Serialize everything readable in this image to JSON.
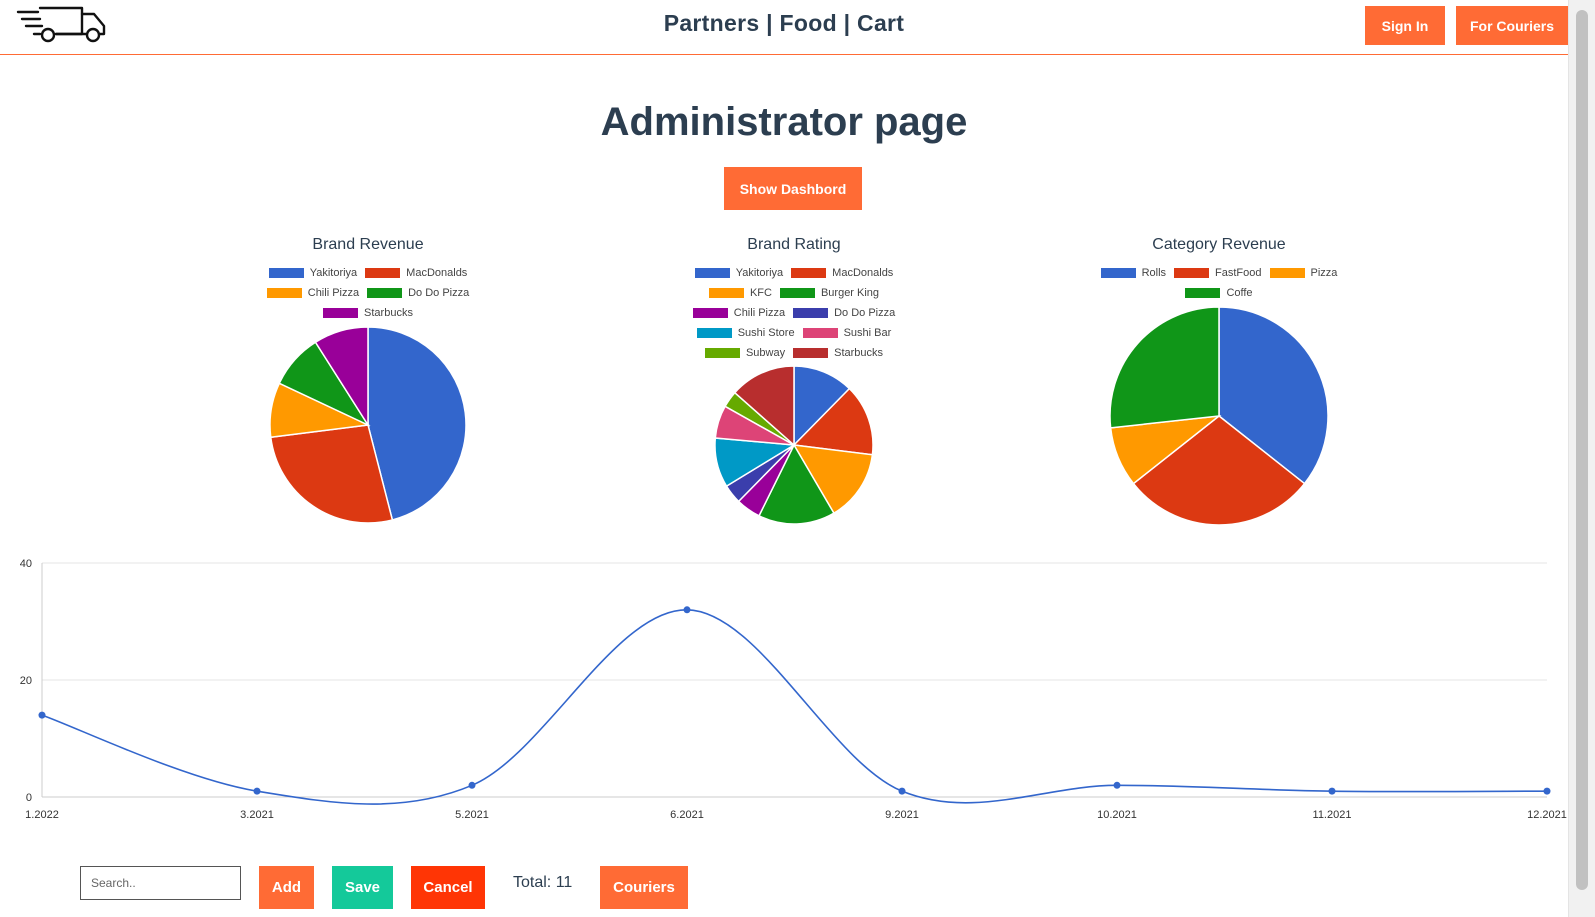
{
  "header": {
    "title": "Partners | Food | Cart",
    "sign_in_label": "Sign In",
    "for_couriers_label": "For Couriers",
    "logo_icon": "delivery-truck-icon"
  },
  "page_title": "Administrator page",
  "show_dashboard_label": "Show Dashbord",
  "chart_data": [
    {
      "type": "pie",
      "title": "Brand Revenue",
      "legend_position": "top",
      "categories": [
        "Yakitoriya",
        "MacDonalds",
        "Chili Pizza",
        "Do Do Pizza",
        "Starbucks"
      ],
      "values": [
        46,
        27,
        9,
        9,
        9
      ],
      "colors": [
        "#3366cc",
        "#dc3912",
        "#ff9900",
        "#109618",
        "#990099"
      ]
    },
    {
      "type": "pie",
      "title": "Brand Rating",
      "legend_position": "top",
      "categories": [
        "Yakitoriya",
        "MacDonalds",
        "KFC",
        "Burger King",
        "Chili Pizza",
        "Do Do Pizza",
        "Sushi Store",
        "Sushi Bar",
        "Subway",
        "Starbucks"
      ],
      "values": [
        11,
        13,
        13,
        14,
        4.5,
        3.5,
        9,
        6,
        3,
        12
      ],
      "colors": [
        "#3366cc",
        "#dc3912",
        "#ff9900",
        "#109618",
        "#990099",
        "#3b3eac",
        "#0099c6",
        "#dd4477",
        "#66aa00",
        "#b82e2e"
      ]
    },
    {
      "type": "pie",
      "title": "Category Revenue",
      "legend_position": "top",
      "categories": [
        "Rolls",
        "FastFood",
        "Pizza",
        "Coffe"
      ],
      "values": [
        36,
        29,
        9,
        27
      ],
      "colors": [
        "#3366cc",
        "#dc3912",
        "#ff9900",
        "#109618"
      ]
    },
    {
      "type": "line",
      "title": "",
      "x": [
        "1.2022",
        "3.2021",
        "5.2021",
        "6.2021",
        "9.2021",
        "10.2021",
        "11.2021",
        "12.2021"
      ],
      "series": [
        {
          "values": [
            14,
            1,
            2,
            32,
            1,
            2,
            1,
            1
          ],
          "color": "#3366cc"
        }
      ],
      "ylim": [
        0,
        40
      ],
      "yticks": [
        "0",
        "20",
        "40"
      ],
      "grid": true,
      "smooth": true
    }
  ],
  "toolbar": {
    "search_placeholder": "Search..",
    "add_label": "Add",
    "save_label": "Save",
    "cancel_label": "Cancel",
    "total_label": "Total: 11",
    "couriers_label": "Couriers"
  }
}
